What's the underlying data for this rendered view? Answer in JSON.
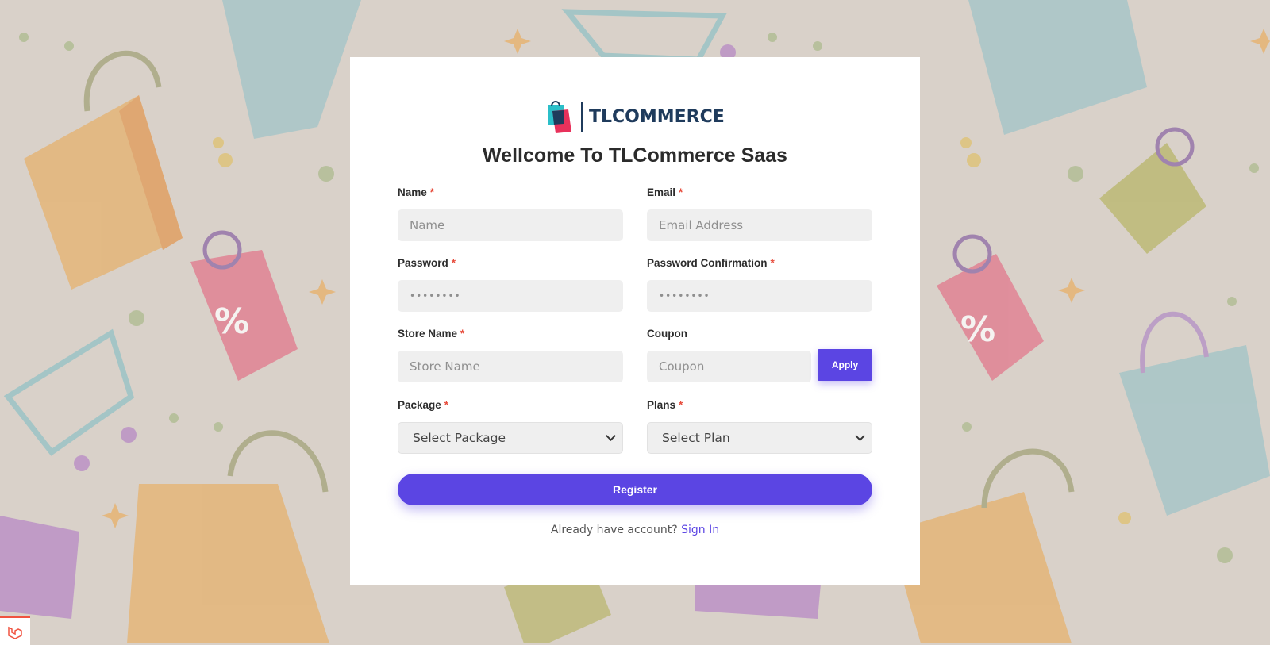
{
  "brand": {
    "logo_text": "TLCOMMERCE",
    "title": "Wellcome To TLCommerce Saas",
    "accent_color": "#5b45e3",
    "required_color": "#e74c3c"
  },
  "form": {
    "name": {
      "label": "Name",
      "required": "*",
      "placeholder": "Name"
    },
    "email": {
      "label": "Email",
      "required": "*",
      "placeholder": "Email Address"
    },
    "password": {
      "label": "Password",
      "required": "*",
      "placeholder": "••••••••"
    },
    "password_confirmation": {
      "label": "Password Confirmation",
      "required": "*",
      "placeholder": "••••••••"
    },
    "store_name": {
      "label": "Store Name",
      "required": "*",
      "placeholder": "Store Name"
    },
    "coupon": {
      "label": "Coupon",
      "placeholder": "Coupon",
      "apply_label": "Apply"
    },
    "package": {
      "label": "Package",
      "required": "*",
      "selected": "Select Package"
    },
    "plans": {
      "label": "Plans",
      "required": "*",
      "selected": "Select Plan"
    },
    "register_label": "Register"
  },
  "footer": {
    "prompt": "Already have account?",
    "signin_label": "Sign In"
  },
  "icons": {
    "logo": "shopping-bags-logo-icon",
    "corner": "laravel-icon"
  }
}
